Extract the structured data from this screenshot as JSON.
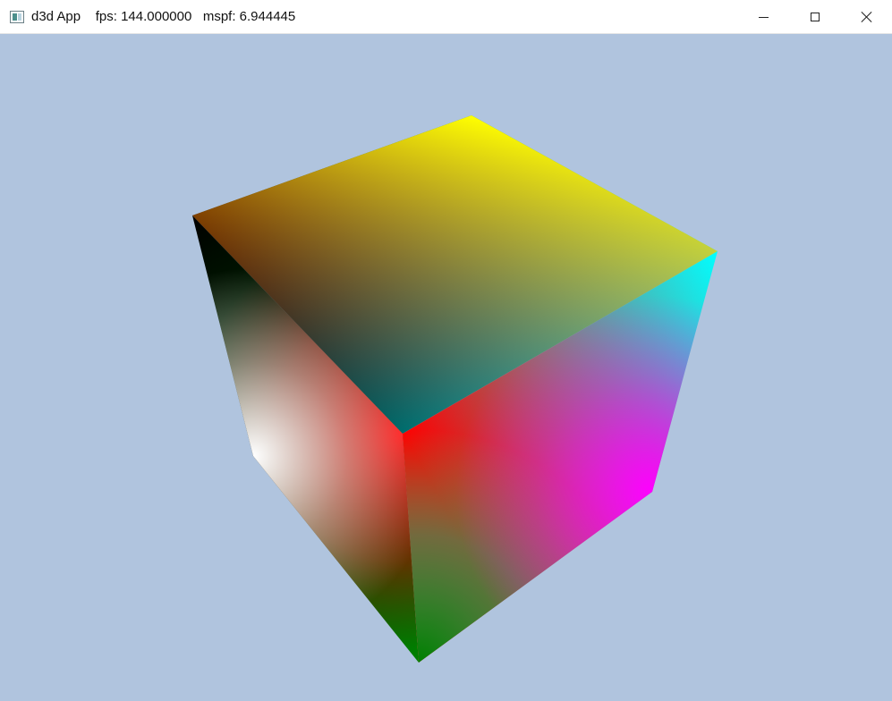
{
  "window": {
    "title": "d3d App    fps: 144.000000   mspf: 6.944445",
    "icon": "app-window-icon",
    "controls": {
      "minimize": "minimize-icon",
      "maximize": "maximize-icon",
      "close": "close-icon"
    }
  },
  "scene": {
    "clear_color": "#b0c4de",
    "object": "rotating color cube",
    "vertex_colors": [
      "#000000",
      "#ffff00",
      "#00ffff",
      "#ff0000",
      "#ffffff",
      "#00ff00",
      "#ff00ff",
      "#008000"
    ]
  }
}
